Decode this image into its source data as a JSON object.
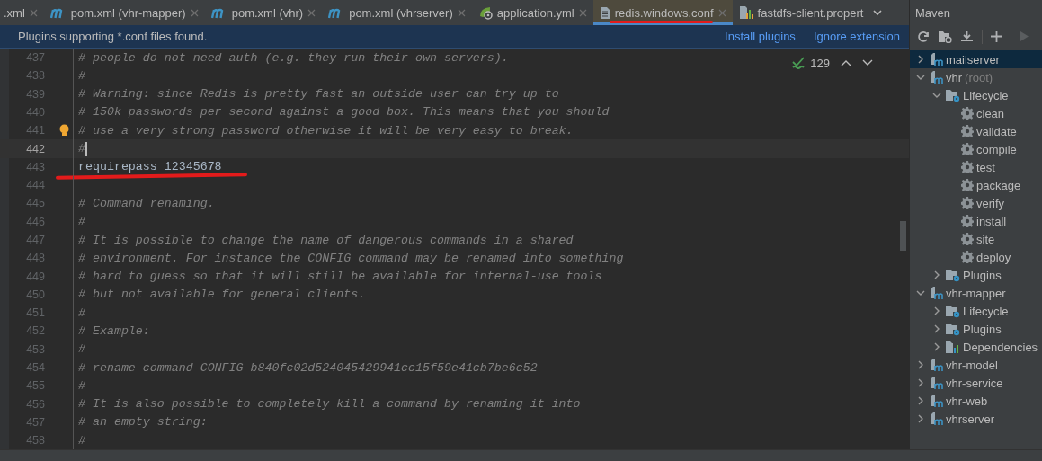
{
  "tabs": [
    {
      "label": ".xml",
      "selected": false,
      "underlined": false,
      "cut": false
    },
    {
      "label": "pom.xml (vhr-mapper)",
      "kind": "maven",
      "selected": false,
      "underlined": false,
      "cut": false
    },
    {
      "label": "pom.xml (vhr)",
      "kind": "maven",
      "selected": false,
      "underlined": false,
      "cut": false
    },
    {
      "label": "pom.xml (vhrserver)",
      "kind": "maven",
      "selected": false,
      "underlined": false,
      "cut": false
    },
    {
      "label": "application.yml",
      "kind": "spring",
      "selected": false,
      "underlined": false,
      "cut": false
    },
    {
      "label": "redis.windows.conf",
      "kind": "text",
      "selected": true,
      "underlined": true,
      "cut": false
    },
    {
      "label": "fastdfs-client.propert",
      "kind": "properties",
      "selected": false,
      "underlined": false,
      "cut": true
    }
  ],
  "notification": {
    "text": "Plugins supporting *.conf files found.",
    "actions": [
      "Install plugins",
      "Ignore extension"
    ]
  },
  "editor": {
    "inspection_count": "129",
    "lines": [
      {
        "number": "437",
        "text": "# people do not need auth (e.g. they run their own servers).",
        "kind": "comment",
        "current": false,
        "bulb": false,
        "underlined": false
      },
      {
        "number": "438",
        "text": "#",
        "kind": "comment",
        "current": false,
        "bulb": false,
        "underlined": false
      },
      {
        "number": "439",
        "text": "# Warning: since Redis is pretty fast an outside user can try up to",
        "kind": "comment",
        "current": false,
        "bulb": false,
        "underlined": false
      },
      {
        "number": "440",
        "text": "# 150k passwords per second against a good box. This means that you should",
        "kind": "comment",
        "current": false,
        "bulb": false,
        "underlined": false
      },
      {
        "number": "441",
        "text": "# use a very strong password otherwise it will be very easy to break.",
        "kind": "comment",
        "current": false,
        "bulb": true,
        "underlined": false
      },
      {
        "number": "442",
        "text": "#",
        "kind": "comment",
        "current": true,
        "bulb": false,
        "underlined": false
      },
      {
        "number": "443",
        "text": "requirepass 12345678",
        "kind": "code",
        "current": false,
        "bulb": false,
        "underlined": true
      },
      {
        "number": "444",
        "kind": "blank",
        "current": false,
        "bulb": false,
        "underlined": false
      },
      {
        "number": "445",
        "text": "# Command renaming.",
        "kind": "comment",
        "current": false,
        "bulb": false,
        "underlined": false
      },
      {
        "number": "446",
        "text": "#",
        "kind": "comment",
        "current": false,
        "bulb": false,
        "underlined": false
      },
      {
        "number": "447",
        "text": "# It is possible to change the name of dangerous commands in a shared",
        "kind": "comment",
        "current": false,
        "bulb": false,
        "underlined": false
      },
      {
        "number": "448",
        "text": "# environment. For instance the CONFIG command may be renamed into something",
        "kind": "comment",
        "current": false,
        "bulb": false,
        "underlined": false
      },
      {
        "number": "449",
        "text": "# hard to guess so that it will still be available for internal-use tools",
        "kind": "comment",
        "current": false,
        "bulb": false,
        "underlined": false
      },
      {
        "number": "450",
        "text": "# but not available for general clients.",
        "kind": "comment",
        "current": false,
        "bulb": false,
        "underlined": false
      },
      {
        "number": "451",
        "text": "#",
        "kind": "comment",
        "current": false,
        "bulb": false,
        "underlined": false
      },
      {
        "number": "452",
        "text": "# Example:",
        "kind": "comment",
        "current": false,
        "bulb": false,
        "underlined": false
      },
      {
        "number": "453",
        "text": "#",
        "kind": "comment",
        "current": false,
        "bulb": false,
        "underlined": false
      },
      {
        "number": "454",
        "text": "# rename-command CONFIG b840fc02d524045429941cc15f59e41cb7be6c52",
        "kind": "comment",
        "current": false,
        "bulb": false,
        "underlined": false
      },
      {
        "number": "455",
        "text": "#",
        "kind": "comment",
        "current": false,
        "bulb": false,
        "underlined": false
      },
      {
        "number": "456",
        "text": "# It is also possible to completely kill a command by renaming it into",
        "kind": "comment",
        "current": false,
        "bulb": false,
        "underlined": false
      },
      {
        "number": "457",
        "text": "# an empty string:",
        "kind": "comment",
        "current": false,
        "bulb": false,
        "underlined": false
      },
      {
        "number": "458",
        "text": "#",
        "kind": "comment",
        "current": false,
        "bulb": false,
        "underlined": false
      }
    ]
  },
  "maven": {
    "title": "Maven",
    "tree": [
      {
        "label": "mailserver",
        "kind": "module",
        "expanded": false,
        "selected": true
      },
      {
        "label": "vhr",
        "note": "(root)",
        "kind": "module",
        "expanded": true,
        "selected": false,
        "children": [
          {
            "label": "Lifecycle",
            "kind": "folder",
            "expanded": true,
            "selected": false,
            "children": [
              {
                "label": "clean",
                "kind": "goal",
                "selected": false
              },
              {
                "label": "validate",
                "kind": "goal",
                "selected": false
              },
              {
                "label": "compile",
                "kind": "goal",
                "selected": false
              },
              {
                "label": "test",
                "kind": "goal",
                "selected": false
              },
              {
                "label": "package",
                "kind": "goal",
                "selected": false
              },
              {
                "label": "verify",
                "kind": "goal",
                "selected": false
              },
              {
                "label": "install",
                "kind": "goal",
                "selected": false
              },
              {
                "label": "site",
                "kind": "goal",
                "selected": false
              },
              {
                "label": "deploy",
                "kind": "goal",
                "selected": false
              }
            ]
          },
          {
            "label": "Plugins",
            "kind": "folder",
            "expanded": false,
            "selected": false
          }
        ]
      },
      {
        "label": "vhr-mapper",
        "kind": "module",
        "expanded": true,
        "selected": false,
        "children": [
          {
            "label": "Lifecycle",
            "kind": "folder",
            "expanded": false,
            "selected": false
          },
          {
            "label": "Plugins",
            "kind": "folder",
            "expanded": false,
            "selected": false
          },
          {
            "label": "Dependencies",
            "kind": "dependencies",
            "expanded": false,
            "selected": false
          }
        ]
      },
      {
        "label": "vhr-model",
        "kind": "module",
        "expanded": false,
        "selected": false
      },
      {
        "label": "vhr-service",
        "kind": "module",
        "expanded": false,
        "selected": false
      },
      {
        "label": "vhr-web",
        "kind": "module",
        "expanded": false,
        "selected": false
      },
      {
        "label": "vhrserver",
        "kind": "module",
        "expanded": false,
        "selected": false
      }
    ]
  }
}
